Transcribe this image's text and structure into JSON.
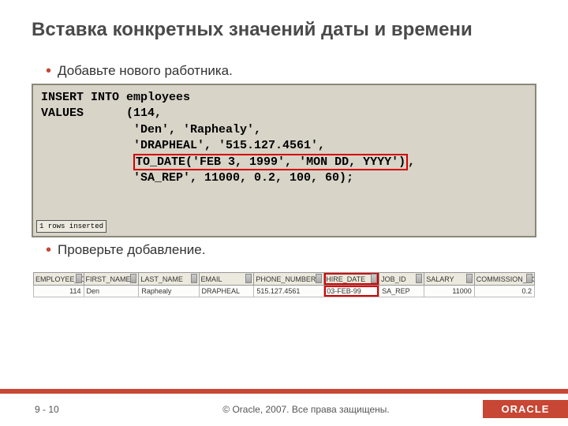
{
  "title": "Вставка конкретных значений даты и времени",
  "bullets": {
    "add": "Добавьте нового работника.",
    "check": "Проверьте добавление."
  },
  "code": {
    "l1": "INSERT INTO employees",
    "l2": "VALUES      (114,",
    "l3": "             'Den', 'Raphealy',",
    "l4": "             'DRAPHEAL', '515.127.4561',",
    "l5_lead": "             ",
    "l5_hl": "TO_DATE('FEB 3, 1999', 'MON DD, YYYY')",
    "l5_tail": ",",
    "l6": "             'SA_REP', 11000, 0.2, 100, 60);",
    "rows_inserted": "1 rows inserted"
  },
  "table": {
    "headers": {
      "emp_id": "EMPLOYEE_ID",
      "first": "FIRST_NAME",
      "last": "LAST_NAME",
      "email": "EMAIL",
      "phone": "PHONE_NUMBER",
      "hire": "HIRE_DATE",
      "job": "JOB_ID",
      "salary": "SALARY",
      "comm": "COMMISSION_PCT"
    },
    "row": {
      "emp_id": "114",
      "first": "Den",
      "last": "Raphealy",
      "email": "DRAPHEAL",
      "phone": "515.127.4561",
      "hire": "03-FEB-99",
      "job": "SA_REP",
      "salary": "11000",
      "comm": "0.2"
    }
  },
  "footer": {
    "page": "9 - 10",
    "copyright": "© Oracle, 2007. Все права защищены.",
    "logo": "ORACLE"
  }
}
